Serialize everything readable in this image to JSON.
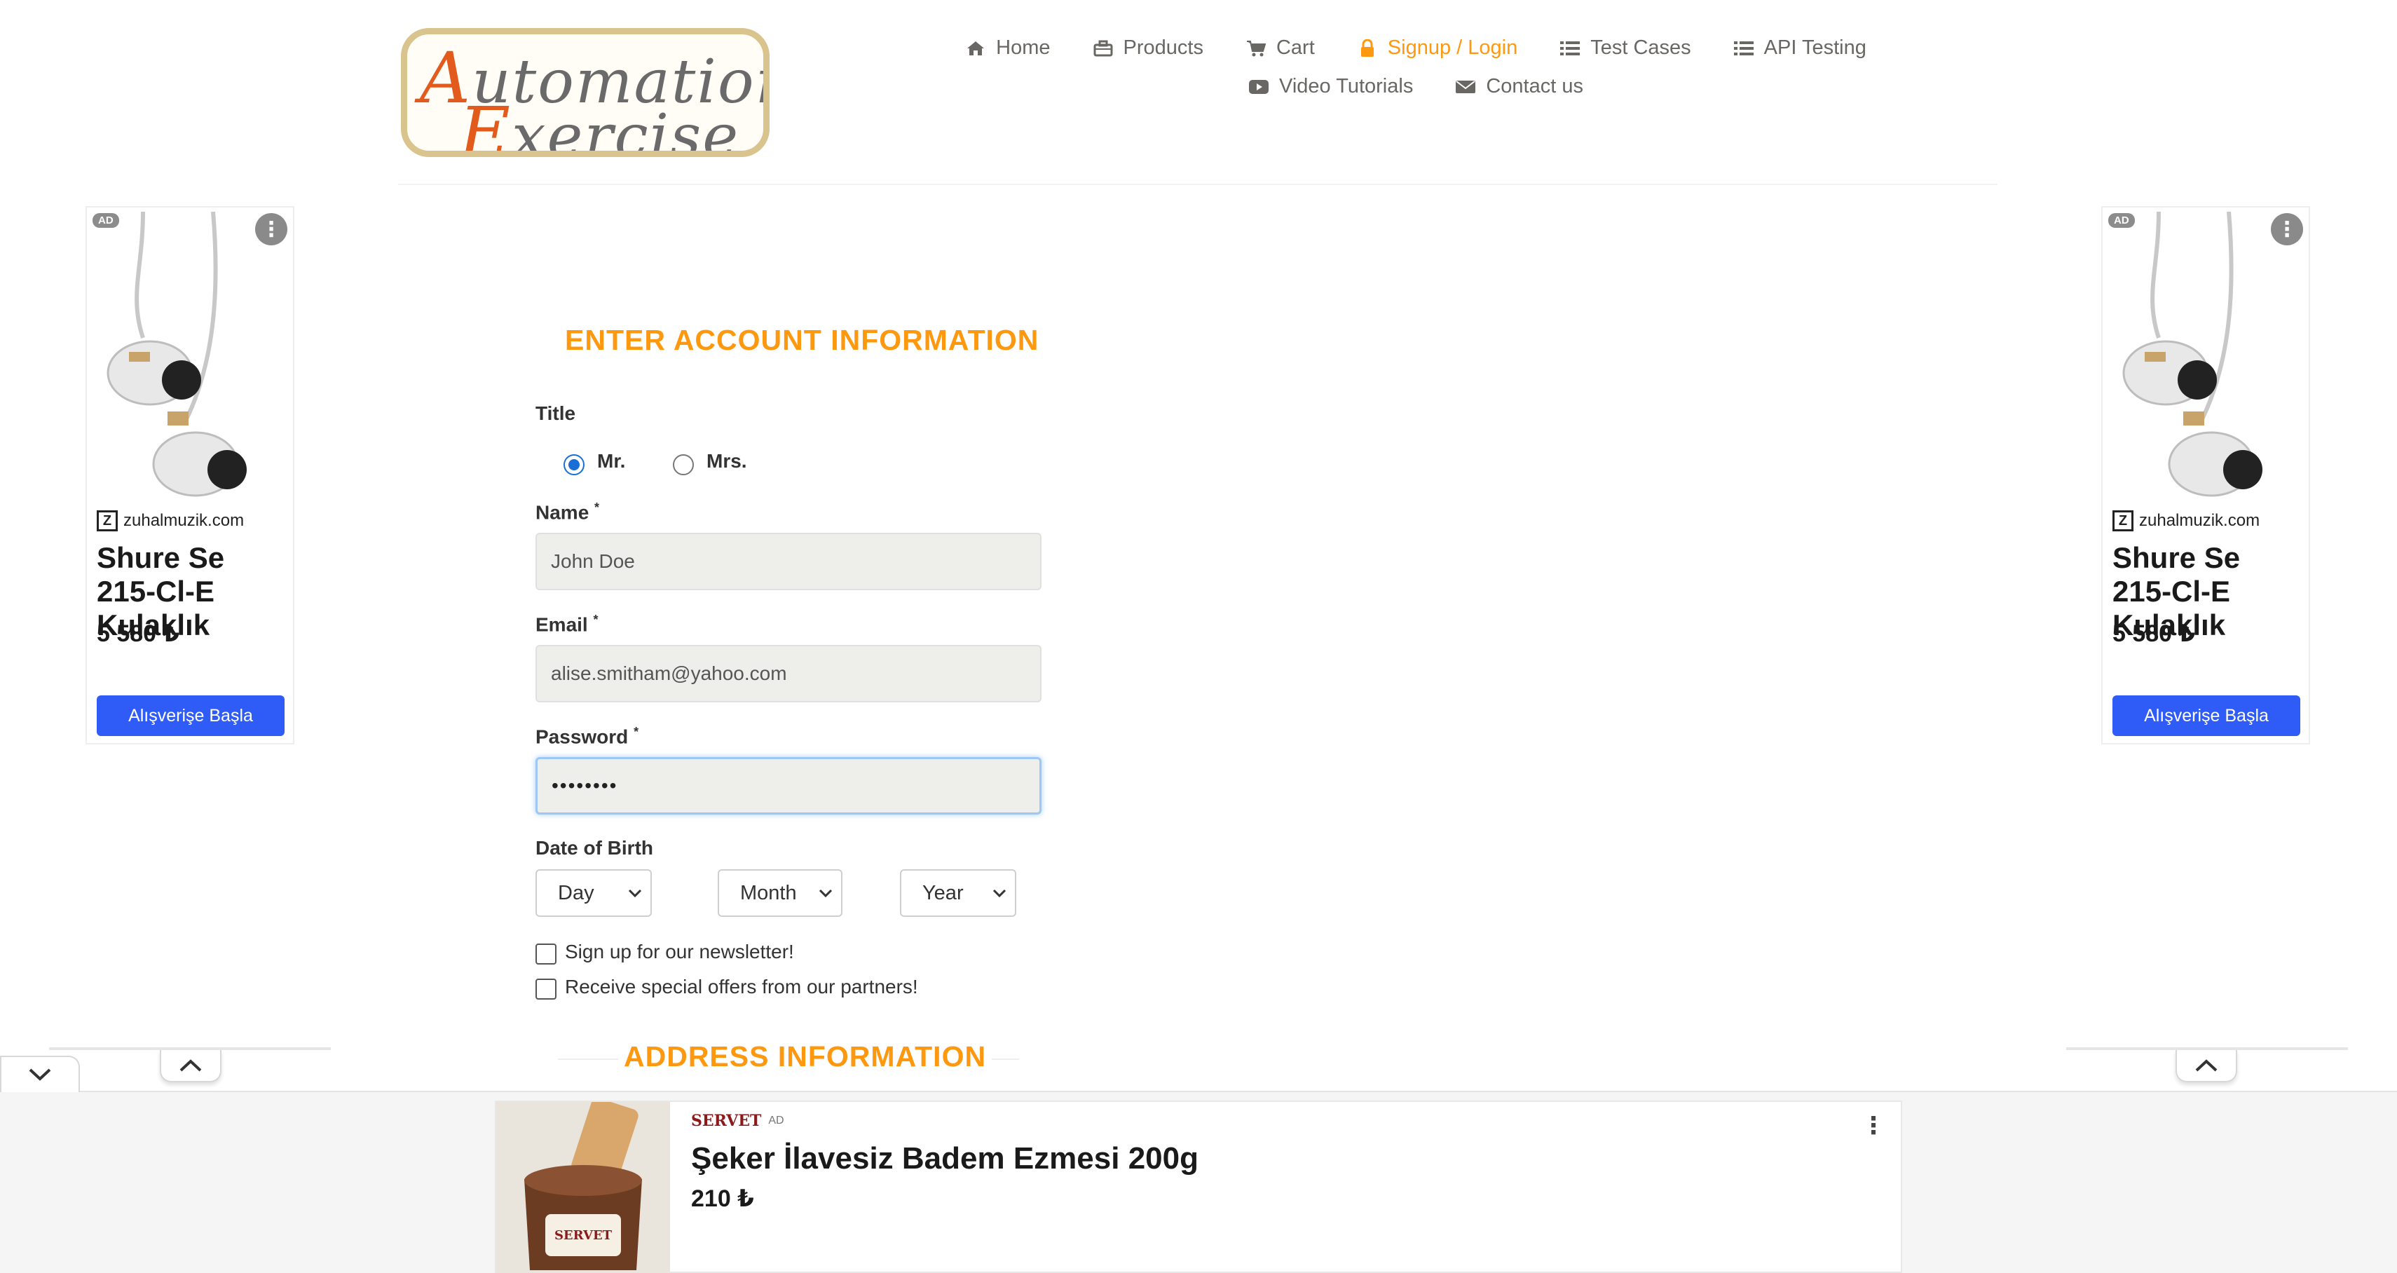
{
  "logo": {
    "line1_cap": "A",
    "line1_rest": "utomation",
    "line2_cap": "E",
    "line2_rest": "xercise"
  },
  "nav": {
    "row1": [
      {
        "label": "Home",
        "icon": "home-icon"
      },
      {
        "label": "Products",
        "icon": "products-icon"
      },
      {
        "label": "Cart",
        "icon": "cart-icon"
      },
      {
        "label": "Signup / Login",
        "icon": "lock-icon",
        "active": true
      },
      {
        "label": "Test Cases",
        "icon": "list-icon"
      },
      {
        "label": "API Testing",
        "icon": "list-icon"
      }
    ],
    "row2": [
      {
        "label": "Video Tutorials",
        "icon": "youtube-icon"
      },
      {
        "label": "Contact us",
        "icon": "envelope-icon"
      }
    ]
  },
  "side_ad": {
    "tag": "AD",
    "domain": "zuhalmuzik.com",
    "title": "Shure Se 215-Cl-E Kulaklık",
    "price": "5 580 ₺",
    "button": "Alışverişe Başla"
  },
  "form": {
    "heading": "ENTER ACCOUNT INFORMATION",
    "title_label": "Title",
    "title_options": [
      "Mr.",
      "Mrs."
    ],
    "title_selected": "Mr.",
    "name_label": "Name",
    "name_value": "John Doe",
    "email_label": "Email",
    "email_value": "alise.smitham@yahoo.com",
    "password_label": "Password",
    "password_value": "••••••••",
    "required_mark": "*",
    "dob_label": "Date of Birth",
    "day": "Day",
    "month": "Month",
    "year": "Year",
    "newsletter": "Sign up for our newsletter!",
    "offers": "Receive special offers from our partners!",
    "address_heading": "ADDRESS INFORMATION"
  },
  "bottom_ad": {
    "brand": "SERVET",
    "tag": "AD",
    "title": "Şeker İlavesiz Badem Ezmesi 200g",
    "price": "210 ₺",
    "menu": "⋮"
  },
  "colors": {
    "accent": "#fe980f",
    "ad_button": "#2f5bf6",
    "radio": "#1a6fd6"
  }
}
